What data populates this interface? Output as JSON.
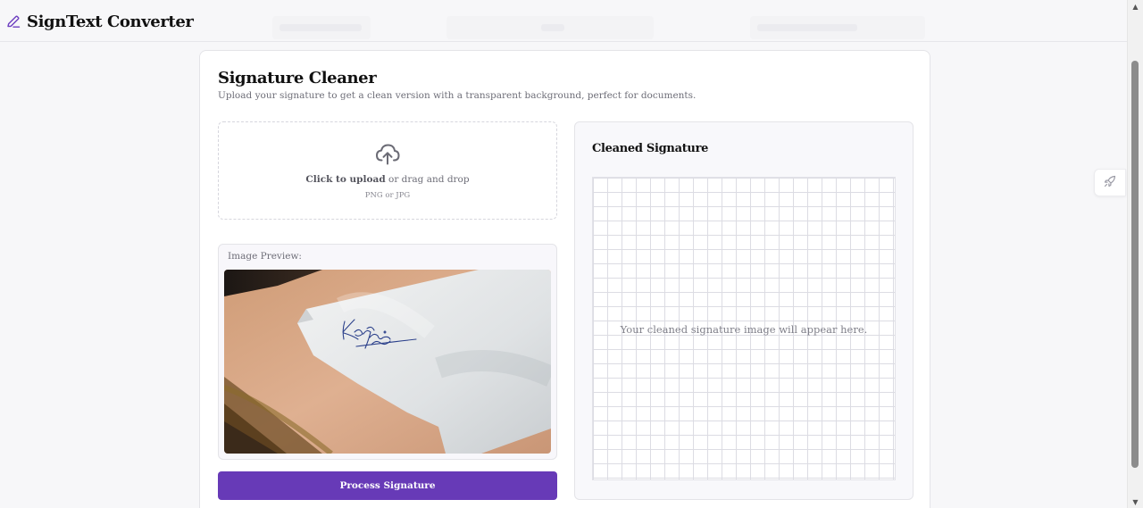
{
  "app": {
    "title": "SignText Converter",
    "accent_color": "#673ab7"
  },
  "card": {
    "title": "Signature Cleaner",
    "subtitle": "Upload your signature to get a clean version with a transparent background, perfect for documents."
  },
  "upload": {
    "icon": "cloud-upload-icon",
    "click_label": "Click to upload",
    "rest_label": " or drag and drop",
    "hint": "PNG or JPG"
  },
  "preview": {
    "label": "Image Preview:"
  },
  "process_button": {
    "label": "Process Signature"
  },
  "output": {
    "title": "Cleaned Signature",
    "placeholder": "Your cleaned signature image will appear here."
  },
  "floating": {
    "icon": "rocket-icon"
  }
}
